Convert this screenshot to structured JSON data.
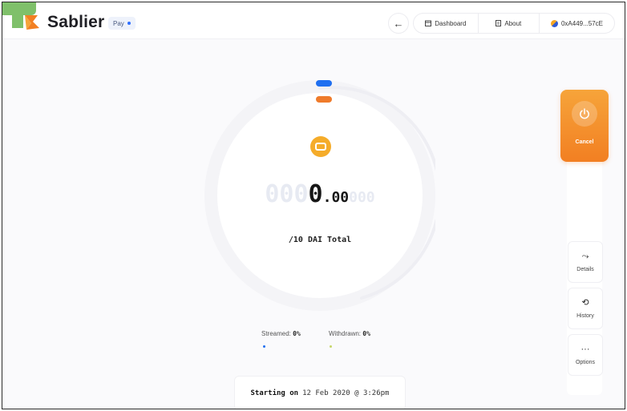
{
  "header": {
    "brand": "Sablier",
    "pay_label": "Pay",
    "nav": {
      "dashboard": "Dashboard",
      "about": "About",
      "address": "0xA449...57cE"
    }
  },
  "stream": {
    "amount_ghost_lead": "000",
    "amount_main": "0",
    "amount_decimals": ".00",
    "amount_ghost_trail": "000",
    "total": "/10 DAI Total",
    "streamed_label": "Streamed:",
    "streamed_value": "0%",
    "withdrawn_label": "Withdrawn:",
    "withdrawn_value": "0%",
    "start_prefix": "Starting on",
    "start_date": "12 Feb 2020 @ 3:26pm"
  },
  "actions": {
    "cancel": "Cancel",
    "details": "Details",
    "history": "History",
    "options": "Options"
  },
  "colors": {
    "streamed": "#1f6ff0",
    "withdrawn": "#ef7b2b",
    "coin": "#f5ac2a"
  },
  "icons": {
    "back": "←",
    "details": "⤳",
    "history": "⟲",
    "options": "···"
  }
}
